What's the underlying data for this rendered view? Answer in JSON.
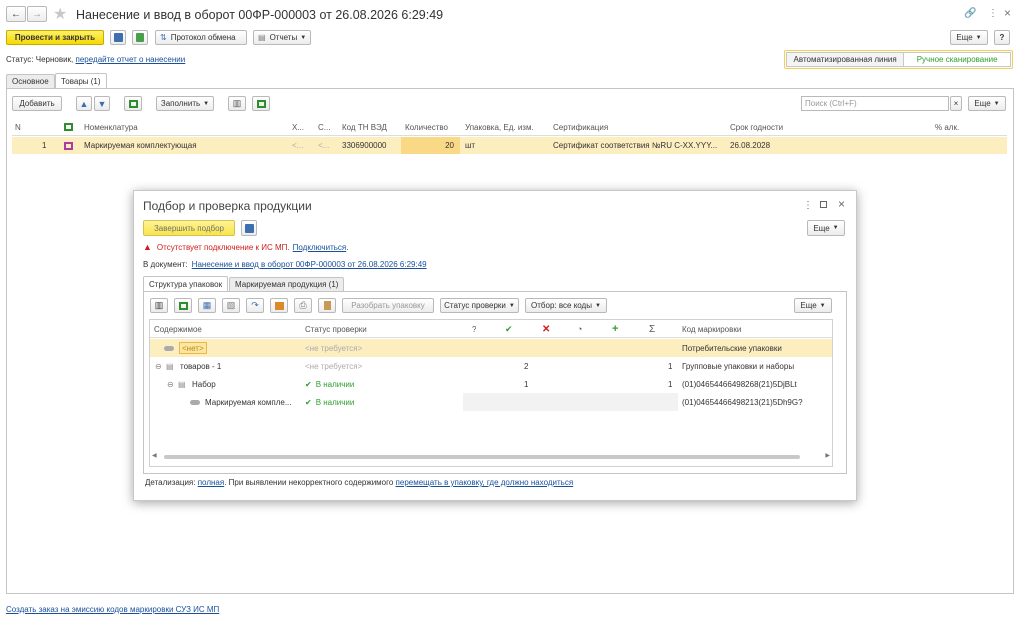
{
  "window": {
    "title": "Нанесение и ввод в оборот 00ФР-000003 от 26.08.2026 6:29:49",
    "more_label": "Еще",
    "help_label": "?"
  },
  "toolbar": {
    "post_close_label": "Провести и закрыть",
    "protocol_label": "Протокол обмена",
    "reports_label": "Отчеты"
  },
  "status": {
    "prefix": "Статус: Черновик,",
    "link": "передайте отчет о нанесении"
  },
  "mode_switch": {
    "auto_line": "Автоматизированная линия",
    "manual_scan": "Ручное сканирование"
  },
  "tabs": {
    "main": "Основное",
    "goods": "Товары (1)"
  },
  "goods_toolbar": {
    "add_label": "Добавить",
    "fill_label": "Заполнить",
    "search_placeholder": "Поиск (Ctrl+F)",
    "clear_label": "×",
    "more_label": "Еще"
  },
  "goods_table": {
    "headers": {
      "n": "N",
      "nomenclature": "Номенклатура",
      "h": "Х...",
      "s": "С...",
      "code": "Код ТН ВЭД",
      "qty": "Количество",
      "pack": "Упаковка, Ед. изм.",
      "cert": "Сертификация",
      "expiry": "Срок годности",
      "percent": "% алк."
    },
    "row": {
      "n": "1",
      "nomenclature": "Маркируемая комплектующая",
      "h": "<...",
      "s": "<...",
      "code": "3306900000",
      "qty": "20",
      "pack": "шт",
      "cert": "Сертификат соответствия №RU C-XX.YYY...",
      "expiry": "26.08.2028"
    }
  },
  "footer_link": "Создать заказ на эмиссию кодов маркировки СУЗ ИС МП",
  "modal": {
    "title": "Подбор и проверка продукции",
    "finish_label": "Завершить подбор",
    "more_label": "Еще",
    "error_text": "Отсутствует подключение к ИС МП.",
    "error_link": "Подключиться",
    "error_dot": ".",
    "doc_prefix": "В документ:",
    "doc_link": "Нанесение и ввод в оборот 00ФР-000003 от 26.08.2026 6:29:49",
    "tabs": {
      "structure": "Структура упаковок",
      "marked": "Маркируемая продукция (1)"
    },
    "inner_toolbar": {
      "unpack_label": "Разобрать упаковку",
      "check_status_label": "Статус проверки",
      "filter_label": "Отбор: все коды",
      "more_label": "Еще"
    },
    "table": {
      "headers": {
        "content": "Содержимое",
        "status": "Статус проверки",
        "q": "?",
        "sum": "Σ",
        "code": "Код маркировки"
      },
      "rows": [
        {
          "content": "<нет>",
          "status": "<не требуется>",
          "c1": "",
          "c2": "",
          "sum": "",
          "code": "Потребительские упаковки"
        },
        {
          "content": "товаров - 1",
          "status": "<не требуется>",
          "c1": "2",
          "c2": "",
          "sum": "1",
          "code": "Групповые упаковки и наборы"
        },
        {
          "content": "Набор",
          "status": "В наличии",
          "c1": "1",
          "c2": "",
          "sum": "1",
          "code": "(01)04654466498268(21)5DjBLt"
        },
        {
          "content": "Маркируемая компле...",
          "status": "В наличии",
          "c1": "",
          "c2": "",
          "sum": "",
          "code": "(01)04654466498213(21)5Dh9G?"
        }
      ]
    },
    "detail": {
      "prefix": "Детализация:",
      "link1": "полная",
      "middle": ". При выявлении некорректного содержимого",
      "link2": "перемещать в упаковку, где должно находиться"
    }
  }
}
